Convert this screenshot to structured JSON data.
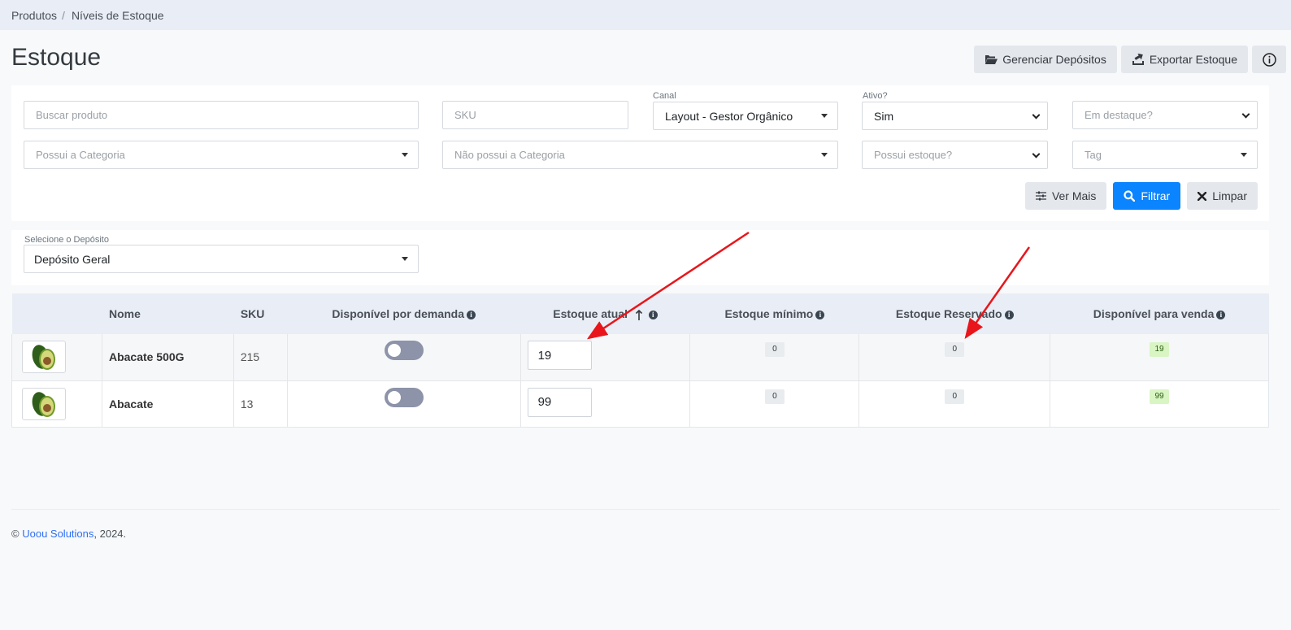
{
  "breadcrumb": {
    "items": [
      "Produtos",
      "Níveis de Estoque"
    ],
    "separator": "/"
  },
  "page": {
    "title": "Estoque"
  },
  "top_actions": {
    "manage_deposits": "Gerenciar Depósitos",
    "export_stock": "Exportar Estoque"
  },
  "filters": {
    "search_placeholder": "Buscar produto",
    "sku_placeholder": "SKU",
    "channel_label": "Canal",
    "channel_value": "Layout - Gestor Orgânico",
    "active_label": "Ativo?",
    "active_value": "Sim",
    "featured_placeholder": "Em destaque?",
    "has_category_placeholder": "Possui a Categoria",
    "not_category_placeholder": "Não possui a Categoria",
    "has_stock_placeholder": "Possui estoque?",
    "tag_placeholder": "Tag",
    "see_more": "Ver Mais",
    "filter": "Filtrar",
    "clear": "Limpar"
  },
  "deposit": {
    "label": "Selecione o Depósito",
    "value": "Depósito Geral"
  },
  "table": {
    "headers": {
      "name": "Nome",
      "sku": "SKU",
      "on_demand": "Disponível por demanda",
      "current_stock": "Estoque atual",
      "min_stock": "Estoque mínimo",
      "reserved": "Estoque Reservado",
      "available": "Disponível para venda"
    },
    "rows": [
      {
        "name": "Abacate 500G",
        "sku": "215",
        "on_demand": false,
        "current_stock": "19",
        "min_stock": "0",
        "reserved": "0",
        "available": "19"
      },
      {
        "name": "Abacate",
        "sku": "13",
        "on_demand": false,
        "current_stock": "99",
        "min_stock": "0",
        "reserved": "0",
        "available": "99"
      }
    ]
  },
  "footer": {
    "copyright": "©",
    "company": "Uoou Solutions",
    "year": ", 2024."
  },
  "colors": {
    "primary": "#0a84ff",
    "annotation_arrow": "#e8161b",
    "available_badge": "#d8f5c3"
  }
}
